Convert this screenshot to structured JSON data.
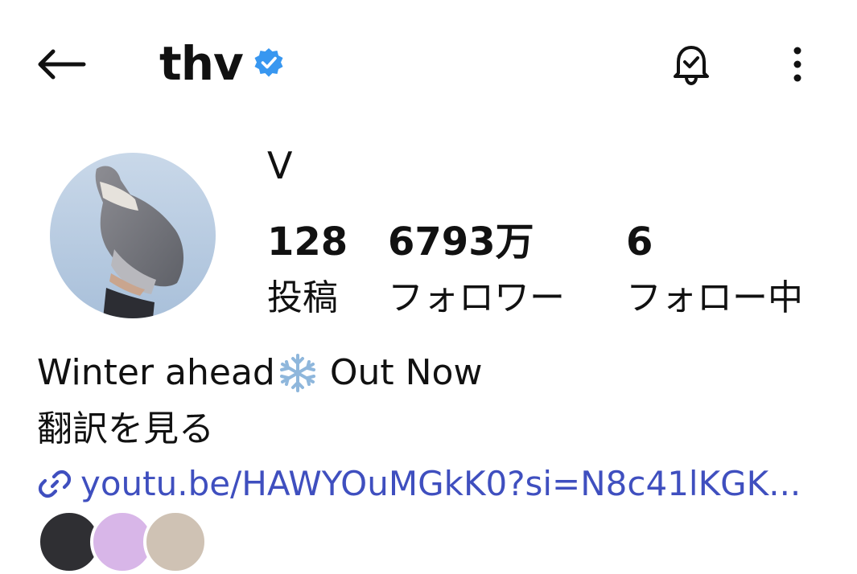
{
  "header": {
    "username": "thv",
    "back_icon": "back-arrow-icon",
    "verified_icon": "verified-badge-icon",
    "bell_icon": "notification-bell-icon",
    "more_icon": "more-vertical-icon"
  },
  "profile": {
    "display_name": "V",
    "avatar": "profile-avatar",
    "stats": [
      {
        "value": "128",
        "label": "投稿"
      },
      {
        "value": "6793万",
        "label": "フォロワー"
      },
      {
        "value": "6",
        "label": "フォロー中"
      }
    ]
  },
  "bio": {
    "text_before": "Winter ahead",
    "emoji_icon": "snowflake-icon",
    "text_after": "Out Now",
    "translate_label": "翻訳を見る",
    "link_icon": "link-icon",
    "link": "youtu.be/HAWYOuMGkK0?si=N8c41lKGK..."
  },
  "colors": {
    "accent_verified": "#3897f0",
    "link": "#3f4fbf",
    "text": "#111111"
  }
}
